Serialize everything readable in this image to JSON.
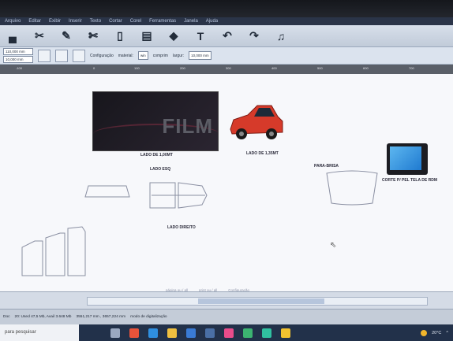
{
  "menu": {
    "items": [
      "Arquivo",
      "Editar",
      "Exibir",
      "Inserir",
      "Texto",
      "Cortar",
      "Corel",
      "Ferramentas",
      "Janela",
      "Ajuda"
    ]
  },
  "toolbar": {
    "configuracao_label": "Configuração",
    "material_label": "material:",
    "material_value": "win",
    "comprimento_label": "comprim",
    "largura_label": "largur:",
    "largura_value": "10,000 mm",
    "x_value": "110,000 mm",
    "y_value": "10,000 mm"
  },
  "ruler": {
    "ticks": [
      "-100",
      "0",
      "100",
      "200",
      "300",
      "400",
      "500",
      "600",
      "700",
      "800"
    ]
  },
  "canvas": {
    "banner_text": "FILM",
    "labels": {
      "lado_esq": "LADO ESQ",
      "lado_direito": "LADO DIREITO",
      "lado_1_label": "LADO DE 1,00MT",
      "truck_label": "LADO DE 1,35MT",
      "para_brisa": "PARA-BRISA",
      "tablet_label": "CORTE P/ PEL TELA DE RDM"
    },
    "page_nav": {
      "pagina": "página ou / all",
      "print": "print ou / all",
      "config": "Configuração"
    }
  },
  "statusbar": {
    "left": "Doc",
    "doc_info": "20: Used 47,5 Mb, Avail 3.648 Mb",
    "coords": "3551,217 mm , 3657,224 mm",
    "mode": "modo de digitalização"
  },
  "taskbar": {
    "search_placeholder": "para pesquisar",
    "weather": "20°C",
    "tray_chevron": "^"
  },
  "colors": {
    "taskbar_bg": "#22314a",
    "truck_red": "#d63a2a"
  }
}
